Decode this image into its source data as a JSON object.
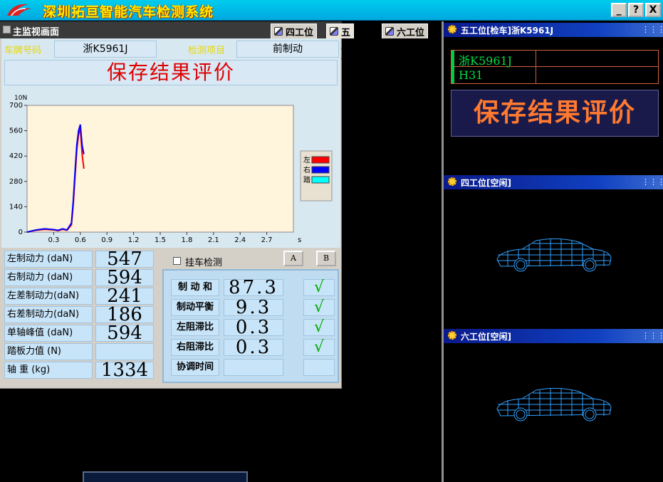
{
  "app": {
    "title": "深圳拓亘智能汽车检测系统",
    "window_buttons": [
      "_",
      "?",
      "X"
    ]
  },
  "main_panel": {
    "header_title": "主监视画面",
    "tabs": [
      {
        "label": "四工位"
      },
      {
        "label": "五工位"
      },
      {
        "label": "六工位"
      }
    ],
    "plate_label": "车牌号码",
    "plate_value": "浙K5961J",
    "item_label": "检测项目",
    "item_value": "前制动",
    "result_text": "保存结果评价"
  },
  "chart_data": {
    "type": "line",
    "ylabel": "10N",
    "xlabel": "s",
    "ylim": [
      0,
      700
    ],
    "xlim": [
      0,
      3.0
    ],
    "yticks": [
      0,
      140,
      280,
      420,
      560,
      700
    ],
    "xticks": [
      0.3,
      0.6,
      0.9,
      1.2,
      1.5,
      1.8,
      2.1,
      2.4,
      2.7
    ],
    "legend": [
      "左",
      "右",
      "踏"
    ],
    "legend_colors": [
      "#ff0000",
      "#0000ff",
      "#00ffff"
    ],
    "legend_position": "right",
    "series": [
      {
        "name": "左",
        "color": "#ff0000",
        "x": [
          0,
          0.1,
          0.2,
          0.3,
          0.35,
          0.4,
          0.45,
          0.5,
          0.52,
          0.54,
          0.56,
          0.58,
          0.6,
          0.62,
          0.64
        ],
        "values": [
          0,
          10,
          15,
          12,
          8,
          15,
          10,
          40,
          150,
          300,
          450,
          540,
          570,
          430,
          350
        ]
      },
      {
        "name": "右",
        "color": "#0000ff",
        "x": [
          0,
          0.1,
          0.2,
          0.3,
          0.35,
          0.4,
          0.45,
          0.5,
          0.52,
          0.54,
          0.56,
          0.58,
          0.6,
          0.62,
          0.64
        ],
        "values": [
          0,
          12,
          18,
          14,
          10,
          18,
          12,
          50,
          170,
          330,
          480,
          560,
          594,
          480,
          430
        ]
      }
    ]
  },
  "left_rows": [
    {
      "label": "左制动力  (daN)",
      "value": "547"
    },
    {
      "label": "右制动力  (daN)",
      "value": "594"
    },
    {
      "label": "左差制动力(daN)",
      "value": "241"
    },
    {
      "label": "右差制动力(daN)",
      "value": "186"
    },
    {
      "label": "单轴峰值  (daN)",
      "value": "594"
    },
    {
      "label": "踏板力值   (N)",
      "value": ""
    },
    {
      "label": "轴    重  (kg)",
      "value": "1334"
    }
  ],
  "controls": {
    "checkbox_label": "挂车检测",
    "btn_a": "A",
    "btn_b": "B"
  },
  "right_rows": [
    {
      "label": "制 动 和",
      "value": "87.3",
      "check": "√"
    },
    {
      "label": "制动平衡",
      "value": "9.3",
      "check": "√"
    },
    {
      "label": "左阻滞比",
      "value": "0.3",
      "check": "√"
    },
    {
      "label": "右阻滞比",
      "value": "0.3",
      "check": "√"
    },
    {
      "label": "协调时间",
      "value": "",
      "check": ""
    }
  ],
  "stations": {
    "five": {
      "title": "五工位[检车]浙K5961J",
      "plate": "浙K5961J",
      "code": "H31",
      "result": "保存结果评价"
    },
    "four": {
      "title": "四工位[空闲]"
    },
    "six": {
      "title": "六工位[空闲]"
    }
  },
  "colors": {
    "title_text": "#ffee00",
    "result_red": "#dd0000",
    "result_orange": "#ff7a30",
    "plate_green": "#00dd44",
    "check_green": "#00aa00"
  }
}
